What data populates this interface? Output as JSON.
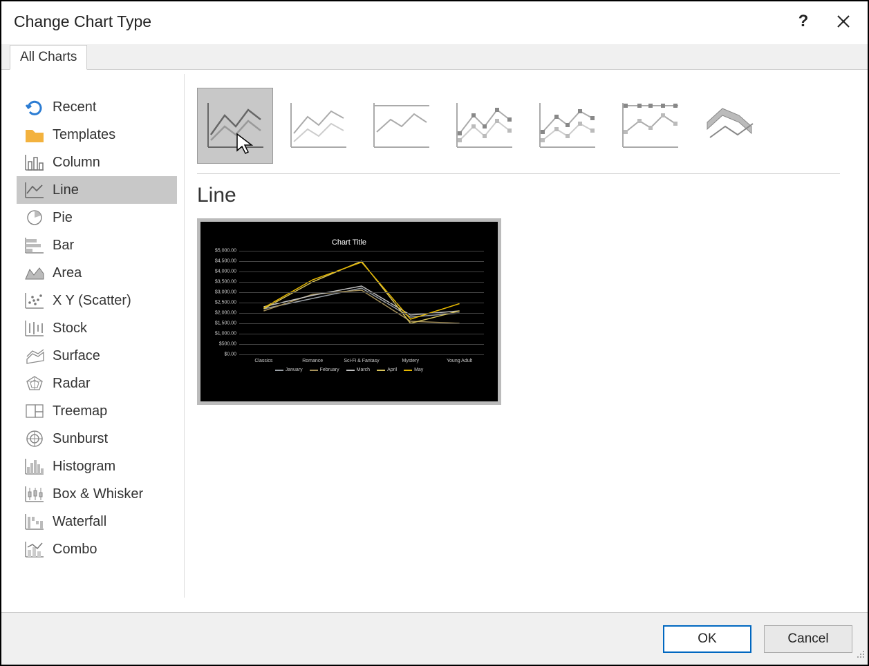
{
  "titlebar": {
    "title": "Change Chart Type"
  },
  "tab": {
    "label": "All Charts"
  },
  "sidebar": {
    "items": [
      {
        "label": "Recent"
      },
      {
        "label": "Templates"
      },
      {
        "label": "Column"
      },
      {
        "label": "Line"
      },
      {
        "label": "Pie"
      },
      {
        "label": "Bar"
      },
      {
        "label": "Area"
      },
      {
        "label": "X Y (Scatter)"
      },
      {
        "label": "Stock"
      },
      {
        "label": "Surface"
      },
      {
        "label": "Radar"
      },
      {
        "label": "Treemap"
      },
      {
        "label": "Sunburst"
      },
      {
        "label": "Histogram"
      },
      {
        "label": "Box & Whisker"
      },
      {
        "label": "Waterfall"
      },
      {
        "label": "Combo"
      }
    ],
    "selected_index": 3
  },
  "subtype_title": "Line",
  "buttons": {
    "ok": "OK",
    "cancel": "Cancel"
  },
  "chart_data": {
    "type": "line",
    "title": "Chart Title",
    "categories": [
      "Classics",
      "Romance",
      "Sci-Fi & Fantasy",
      "Mystery",
      "Young Adult"
    ],
    "y_ticks": [
      "$0.00",
      "$500.00",
      "$1,000.00",
      "$1,500.00",
      "$2,000.00",
      "$2,500.00",
      "$3,000.00",
      "$3,500.00",
      "$4,000.00",
      "$4,500.00",
      "$5,000.00"
    ],
    "ylim": [
      0,
      5000
    ],
    "series": [
      {
        "name": "January",
        "color": "#9aa0a6",
        "values": [
          2200,
          2700,
          3200,
          1800,
          2000
        ]
      },
      {
        "name": "February",
        "color": "#a6915a",
        "values": [
          2100,
          2900,
          3100,
          1600,
          1500
        ]
      },
      {
        "name": "March",
        "color": "#bfbfbf",
        "values": [
          2300,
          2850,
          3300,
          1900,
          2100
        ]
      },
      {
        "name": "April",
        "color": "#d6c25a",
        "values": [
          2200,
          3500,
          4500,
          1500,
          2100
        ]
      },
      {
        "name": "May",
        "color": "#e6b800",
        "values": [
          2250,
          3600,
          4450,
          1700,
          2450
        ]
      }
    ]
  }
}
